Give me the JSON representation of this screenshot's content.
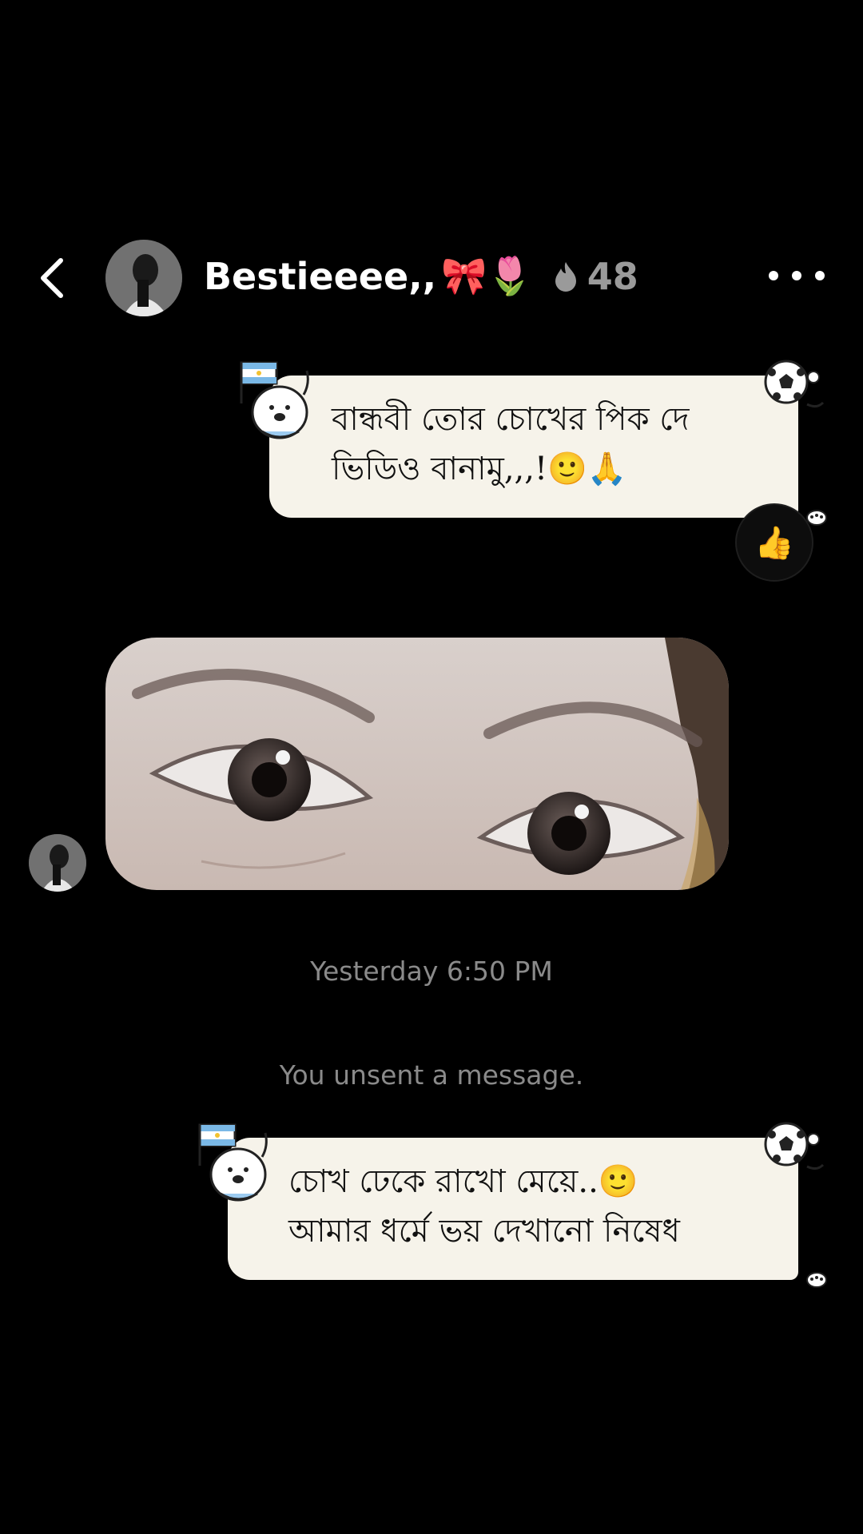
{
  "header": {
    "name": "Bestieeee,,",
    "name_emojis": "🎀🌷",
    "streak_count": "48",
    "back_icon": "chevron-left-icon",
    "more_icon": "more-horizontal-icon"
  },
  "messages": [
    {
      "line1": "বান্ধবী তোর চোখের পিক দে",
      "line2": "ভিডিও বানামু,,,!🙂🙏",
      "reaction": "👍"
    },
    {
      "line1": "চোখ ঢেকে  রাখো মেয়ে..🙂",
      "line2": "আমার ধর্মে ভয় দেখানো নিষেধ"
    }
  ],
  "timestamp": "Yesterday 6:50 PM",
  "unsent_notice": "You unsent a message.",
  "colors": {
    "background": "#000000",
    "bubble": "#f6f3ea",
    "muted": "#8a8a8a"
  }
}
